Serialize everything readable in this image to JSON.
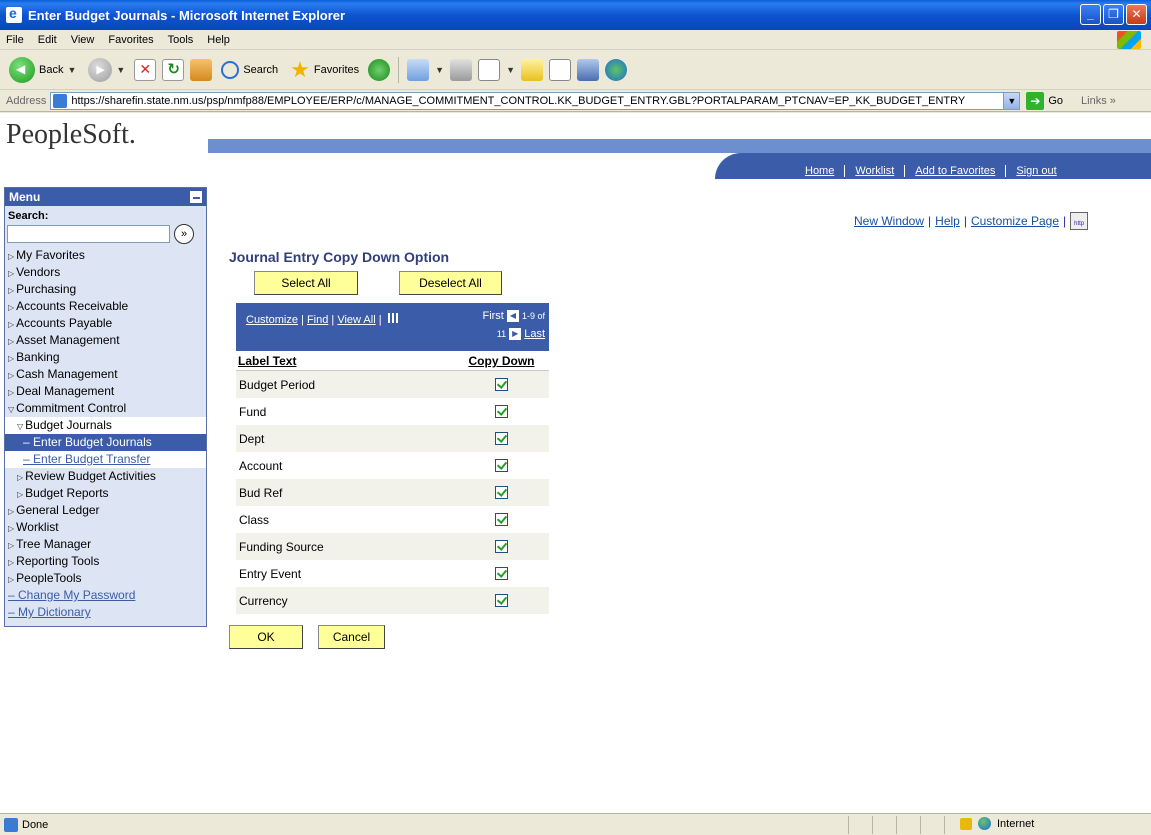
{
  "window": {
    "title": "Enter Budget Journals - Microsoft Internet Explorer"
  },
  "menubar": [
    "File",
    "Edit",
    "View",
    "Favorites",
    "Tools",
    "Help"
  ],
  "toolbar": {
    "back_label": "Back",
    "search_label": "Search",
    "favorites_label": "Favorites"
  },
  "address": {
    "label": "Address",
    "url": "https://sharefin.state.nm.us/psp/nmfp88/EMPLOYEE/ERP/c/MANAGE_COMMITMENT_CONTROL.KK_BUDGET_ENTRY.GBL?PORTALPARAM_PTCNAV=EP_KK_BUDGET_ENTRY",
    "go_label": "Go",
    "links_label": "Links"
  },
  "header": {
    "logo": "PeopleSoft.",
    "nav": [
      "Home",
      "Worklist",
      "Add to Favorites",
      "Sign out"
    ]
  },
  "sidebar": {
    "title": "Menu",
    "search_label": "Search:",
    "items": [
      {
        "label": "My Favorites"
      },
      {
        "label": "Vendors"
      },
      {
        "label": "Purchasing"
      },
      {
        "label": "Accounts Receivable"
      },
      {
        "label": "Accounts Payable"
      },
      {
        "label": "Asset Management"
      },
      {
        "label": "Banking"
      },
      {
        "label": "Cash Management"
      },
      {
        "label": "Deal Management"
      },
      {
        "label": "Commitment Control"
      },
      {
        "label": "Budget Journals"
      },
      {
        "label": "Enter Budget Journals"
      },
      {
        "label": "Enter Budget Transfer"
      },
      {
        "label": "Review Budget Activities"
      },
      {
        "label": "Budget Reports"
      },
      {
        "label": "General Ledger"
      },
      {
        "label": "Worklist"
      },
      {
        "label": "Tree Manager"
      },
      {
        "label": "Reporting Tools"
      },
      {
        "label": "PeopleTools"
      },
      {
        "label": "Change My Password"
      },
      {
        "label": "My Dictionary"
      }
    ]
  },
  "page_links": {
    "new_window": "New Window",
    "help": "Help",
    "customize": "Customize Page",
    "http_icon_text": "http"
  },
  "journal": {
    "title": "Journal Entry Copy Down Option",
    "select_all": "Select All",
    "deselect_all": "Deselect All",
    "grid_links": {
      "customize": "Customize",
      "find": "Find",
      "view_all": "View All",
      "first": "First",
      "range": "1-9 of",
      "total": "11",
      "last": "Last"
    },
    "col_label": "Label Text",
    "col_copy": "Copy Down",
    "rows": [
      {
        "label": "Budget Period",
        "checked": true
      },
      {
        "label": "Fund",
        "checked": true
      },
      {
        "label": "Dept",
        "checked": true
      },
      {
        "label": "Account",
        "checked": true
      },
      {
        "label": "Bud Ref",
        "checked": true
      },
      {
        "label": "Class",
        "checked": true
      },
      {
        "label": "Funding Source",
        "checked": true
      },
      {
        "label": "Entry Event",
        "checked": true
      },
      {
        "label": "Currency",
        "checked": true
      }
    ],
    "ok": "OK",
    "cancel": "Cancel"
  },
  "status": {
    "text": "Done",
    "zone": "Internet"
  }
}
